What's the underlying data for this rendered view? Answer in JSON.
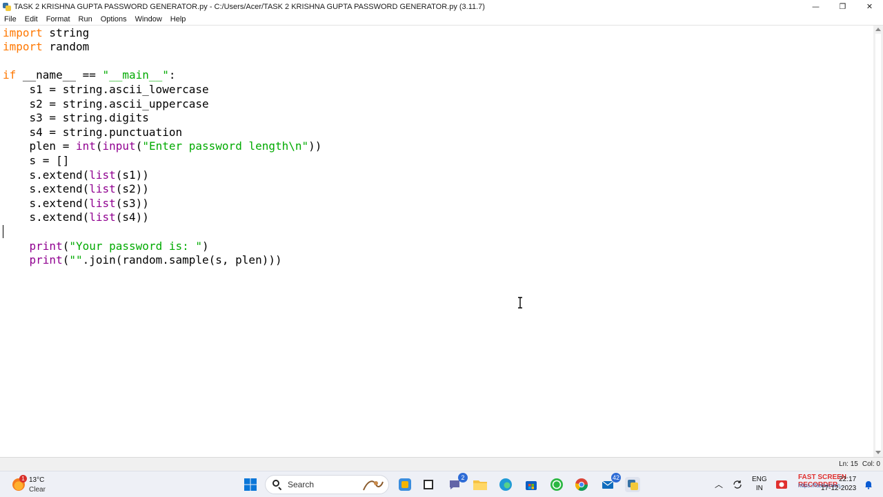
{
  "window": {
    "title": "TASK 2  KRISHNA GUPTA PASSWORD GENERATOR.py - C:/Users/Acer/TASK 2  KRISHNA GUPTA PASSWORD GENERATOR.py (3.11.7)",
    "minimize_glyph": "—",
    "maximize_glyph": "❐",
    "close_glyph": "✕"
  },
  "menu": {
    "items": [
      "File",
      "Edit",
      "Format",
      "Run",
      "Options",
      "Window",
      "Help"
    ]
  },
  "editor": {
    "lines": [
      [
        {
          "t": "import",
          "c": "kw"
        },
        {
          "t": " string"
        }
      ],
      [
        {
          "t": "import",
          "c": "kw"
        },
        {
          "t": " random"
        }
      ],
      [],
      [
        {
          "t": "if",
          "c": "kw"
        },
        {
          "t": " __name__ == "
        },
        {
          "t": "\"__main__\"",
          "c": "str"
        },
        {
          "t": ":"
        }
      ],
      [
        {
          "t": "    s1 = string.ascii_lowercase"
        }
      ],
      [
        {
          "t": "    s2 = string.ascii_uppercase"
        }
      ],
      [
        {
          "t": "    s3 = string.digits"
        }
      ],
      [
        {
          "t": "    s4 = string.punctuation"
        }
      ],
      [
        {
          "t": "    plen = "
        },
        {
          "t": "int",
          "c": "bi"
        },
        {
          "t": "("
        },
        {
          "t": "input",
          "c": "bi"
        },
        {
          "t": "("
        },
        {
          "t": "\"Enter password length\\n\"",
          "c": "str"
        },
        {
          "t": "))"
        }
      ],
      [
        {
          "t": "    s = []"
        }
      ],
      [
        {
          "t": "    s.extend("
        },
        {
          "t": "list",
          "c": "bi"
        },
        {
          "t": "(s1))"
        }
      ],
      [
        {
          "t": "    s.extend("
        },
        {
          "t": "list",
          "c": "bi"
        },
        {
          "t": "(s2))"
        }
      ],
      [
        {
          "t": "    s.extend("
        },
        {
          "t": "list",
          "c": "bi"
        },
        {
          "t": "(s3))"
        }
      ],
      [
        {
          "t": "    s.extend("
        },
        {
          "t": "list",
          "c": "bi"
        },
        {
          "t": "(s4))"
        }
      ],
      [],
      [
        {
          "t": "    "
        },
        {
          "t": "print",
          "c": "bi"
        },
        {
          "t": "("
        },
        {
          "t": "\"Your password is: \"",
          "c": "str"
        },
        {
          "t": ")"
        }
      ],
      [
        {
          "t": "    "
        },
        {
          "t": "print",
          "c": "bi"
        },
        {
          "t": "("
        },
        {
          "t": "\"\"",
          "c": "str"
        },
        {
          "t": ".join(random.sample(s, plen)))"
        }
      ]
    ],
    "colors": {
      "keyword": "#ff7700",
      "string": "#00aa00",
      "builtin": "#900090"
    }
  },
  "status": {
    "line": "Ln: 15",
    "col": "Col: 0"
  },
  "taskbar": {
    "weather": {
      "badge": "1",
      "temp": "13°C",
      "condition": "Clear"
    },
    "search_label": "Search",
    "teams_badge": "2",
    "mail_badge": "42",
    "language": {
      "line1": "ENG",
      "line2": "IN"
    },
    "clock": {
      "time": "22:17",
      "date": "17-12-2023"
    },
    "watermark": {
      "title": "FAST SCREEN RECORDER",
      "sub": "https://fastscreen..."
    }
  }
}
